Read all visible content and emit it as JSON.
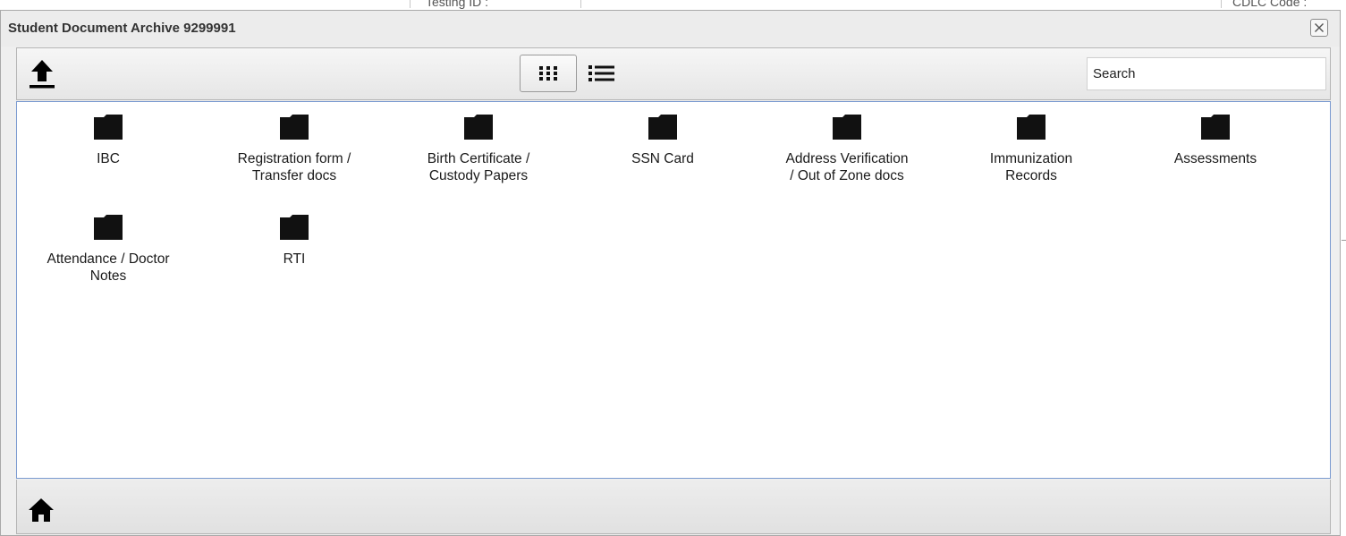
{
  "dialog": {
    "title": "Student Document Archive 9299991",
    "close_icon": "close-icon"
  },
  "background": {
    "field_1_text": "Testing ID :",
    "field_2_text": "CDLC Code :"
  },
  "toolbar": {
    "upload_icon": "upload-icon",
    "grid_view_icon": "grid-view-icon",
    "list_view_icon": "list-view-icon",
    "search": {
      "placeholder": "Search",
      "value": ""
    }
  },
  "folders": [
    {
      "label": "IBC"
    },
    {
      "label": "Registration form /\nTransfer docs"
    },
    {
      "label": "Birth Certificate /\nCustody Papers"
    },
    {
      "label": "SSN Card"
    },
    {
      "label": "Address Verification\n/ Out of Zone docs"
    },
    {
      "label": "Immunization\nRecords"
    },
    {
      "label": "Assessments"
    },
    {
      "label": "Attendance / Doctor\nNotes"
    },
    {
      "label": "RTI"
    }
  ],
  "footer": {
    "home_icon": "home-icon"
  },
  "colors": {
    "folder": "#111111",
    "content_border": "#7a9ad0",
    "dialog_bg": "#efefef"
  }
}
